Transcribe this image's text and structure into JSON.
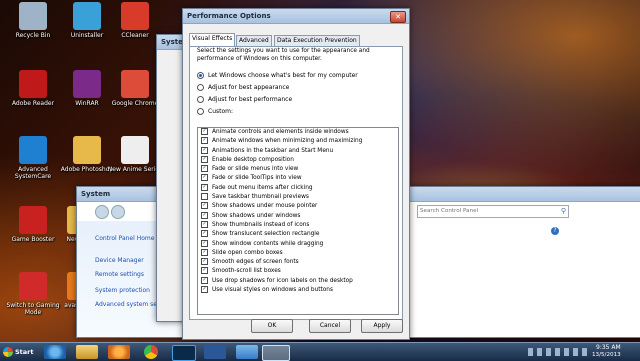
{
  "desktop_icons": [
    {
      "label": "Recycle Bin",
      "color": "#9fb3c8"
    },
    {
      "label": "Uninstaller",
      "color": "#3aa0d8"
    },
    {
      "label": "CCleaner",
      "color": "#d83b2a"
    },
    {
      "label": "Adobe Reader",
      "color": "#c0191a"
    },
    {
      "label": "WinRAR",
      "color": "#7b2a8a"
    },
    {
      "label": "Google Chrome",
      "color": "#dd4b39"
    },
    {
      "label": "Advanced SystemCare",
      "color": "#1f7fd0"
    },
    {
      "label": "Adobe Photoshop",
      "color": "#e7b84a"
    },
    {
      "label": "New Anime Series",
      "color": "#eeeeee"
    },
    {
      "label": "Game Booster",
      "color": "#c92020"
    },
    {
      "label": "New docs",
      "color": "#e7b84a"
    },
    {
      "label": "Switch to Gaming Mode",
      "color": "#d02a2a"
    },
    {
      "label": "avast! Free",
      "color": "#e87a1c"
    }
  ],
  "system_window": {
    "title": "System",
    "nav": "Control Panel Home",
    "links": [
      "Device Manager",
      "Remote settings",
      "System protection",
      "Advanced system settings"
    ],
    "search_placeholder": "Search Control Panel"
  },
  "sys_props_title": "Syste",
  "dialog": {
    "title": "Performance Options",
    "tabs": [
      "Visual Effects",
      "Advanced",
      "Data Execution Prevention"
    ],
    "active_tab": 0,
    "description": "Select the settings you want to use for the appearance and performance of Windows on this computer.",
    "options": [
      {
        "label": "Let Windows choose what's best for my computer",
        "selected": true
      },
      {
        "label": "Adjust for best appearance",
        "selected": false
      },
      {
        "label": "Adjust for best performance",
        "selected": false
      },
      {
        "label": "Custom:",
        "selected": false
      }
    ],
    "effects": [
      {
        "label": "Animate controls and elements inside windows",
        "checked": true
      },
      {
        "label": "Animate windows when minimizing and maximizing",
        "checked": true
      },
      {
        "label": "Animations in the taskbar and Start Menu",
        "checked": true
      },
      {
        "label": "Enable desktop composition",
        "checked": true
      },
      {
        "label": "Fade or slide menus into view",
        "checked": true
      },
      {
        "label": "Fade or slide ToolTips into view",
        "checked": true
      },
      {
        "label": "Fade out menu items after clicking",
        "checked": true
      },
      {
        "label": "Save taskbar thumbnail previews",
        "checked": false
      },
      {
        "label": "Show shadows under mouse pointer",
        "checked": true
      },
      {
        "label": "Show shadows under windows",
        "checked": true
      },
      {
        "label": "Show thumbnails instead of icons",
        "checked": true
      },
      {
        "label": "Show translucent selection rectangle",
        "checked": true
      },
      {
        "label": "Show window contents while dragging",
        "checked": true
      },
      {
        "label": "Slide open combo boxes",
        "checked": true
      },
      {
        "label": "Smooth edges of screen fonts",
        "checked": true
      },
      {
        "label": "Smooth-scroll list boxes",
        "checked": true
      },
      {
        "label": "Use drop shadows for icon labels on the desktop",
        "checked": true
      },
      {
        "label": "Use visual styles on windows and buttons",
        "checked": true
      }
    ],
    "buttons": {
      "ok": "OK",
      "cancel": "Cancel",
      "apply": "Apply"
    }
  },
  "taskbar": {
    "start": "Start",
    "time": "9:35 AM",
    "date": "13/5/2013"
  }
}
